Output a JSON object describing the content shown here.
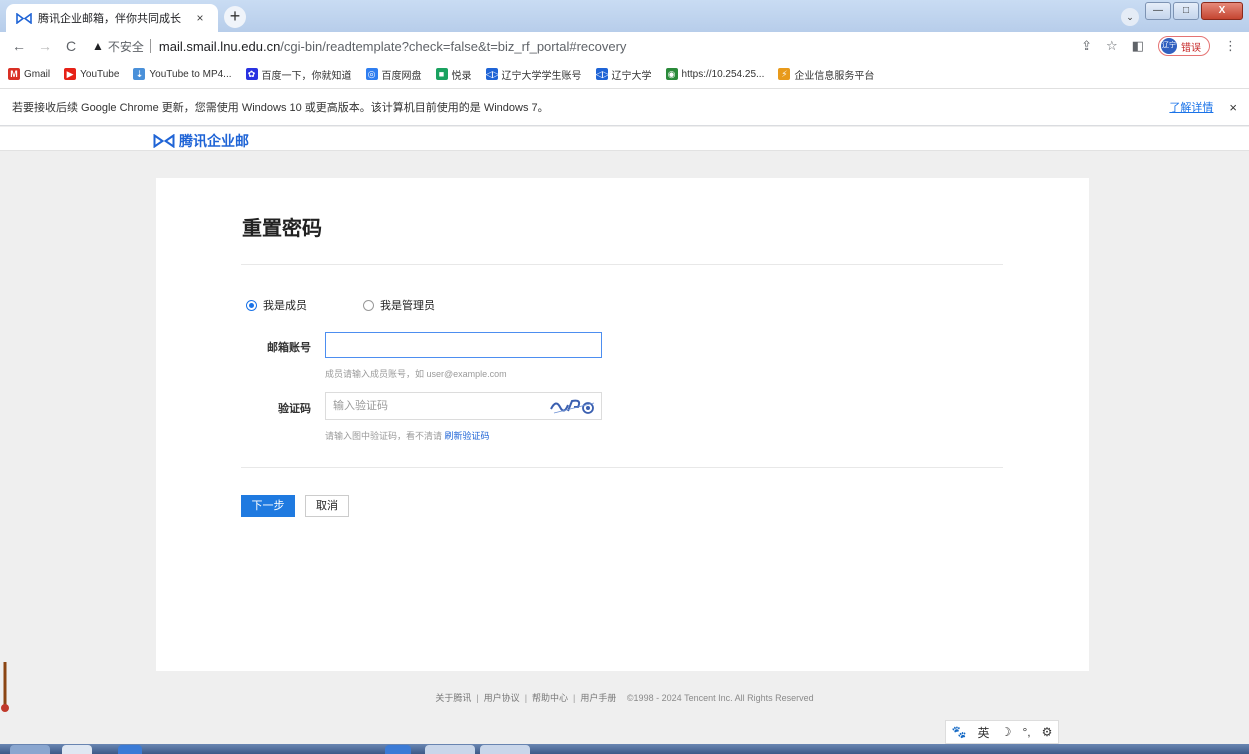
{
  "browser": {
    "tab_title": "腾讯企业邮箱，伴你共同成长",
    "tab_close": "×",
    "new_tab": "+",
    "win_min": "—",
    "win_max": "□",
    "win_close": "X",
    "back": "←",
    "forward": "→",
    "reload": "C",
    "insecure_label": "不安全",
    "url_host": "mail.smail.lnu.edu.cn",
    "url_path": "/cgi-bin/readtemplate?check=false&t=biz_rf_portal#recovery",
    "profile_label": "错误",
    "profile_avatar": "辽宁",
    "menu": "⋮"
  },
  "bookmarks": [
    {
      "label": "Gmail",
      "icon": "gmail-icon",
      "color": "#d93025",
      "glyph": "M"
    },
    {
      "label": "YouTube",
      "icon": "youtube-icon",
      "color": "#e62117",
      "glyph": "▶"
    },
    {
      "label": "YouTube to MP4...",
      "icon": "download-icon",
      "color": "#4a90d9",
      "glyph": "⇣"
    },
    {
      "label": "百度一下，你就知道",
      "icon": "baidu-icon",
      "color": "#2932e1",
      "glyph": "✿"
    },
    {
      "label": "百度网盘",
      "icon": "cloud-icon",
      "color": "#2f7ef0",
      "glyph": "◎"
    },
    {
      "label": "悦录",
      "icon": "app-icon",
      "color": "#1aa260",
      "glyph": "■"
    },
    {
      "label": "辽宁大学学生账号",
      "icon": "mail-logo-icon",
      "color": "#1f64d6",
      "glyph": "◁▷"
    },
    {
      "label": "辽宁大学",
      "icon": "mail-logo-icon",
      "color": "#1f64d6",
      "glyph": "◁▷"
    },
    {
      "label": "https://10.254.25...",
      "icon": "globe-icon",
      "color": "#2a8a3a",
      "glyph": "◉"
    },
    {
      "label": "企业信息服务平台",
      "icon": "service-icon",
      "color": "#e89a1b",
      "glyph": "⚡"
    }
  ],
  "infobar": {
    "text": "若要接收后续 Google Chrome 更新，您需使用 Windows 10 或更高版本。该计算机目前使用的是 Windows 7。",
    "link": "了解详情",
    "close": "×"
  },
  "brand": {
    "name": "腾讯企业邮"
  },
  "form": {
    "title": "重置密码",
    "radio_member": "我是成员",
    "radio_admin": "我是管理员",
    "selected": "member",
    "email_label": "邮箱账号",
    "email_value": "",
    "email_hint": "成员请输入成员账号，如 user@example.com",
    "captcha_label": "验证码",
    "captcha_placeholder": "输入验证码",
    "captcha_hint": "请输入图中验证码，看不清请",
    "captcha_refresh": "刷新验证码",
    "next_button": "下一步",
    "cancel_button": "取消"
  },
  "footer": {
    "links": [
      "关于腾讯",
      "用户协议",
      "帮助中心",
      "用户手册"
    ],
    "copyright": "©1998 - 2024 Tencent Inc. All Rights Reserved"
  },
  "ime": {
    "items": [
      "🐾",
      "英",
      "☽",
      "°,",
      "⚙"
    ]
  }
}
